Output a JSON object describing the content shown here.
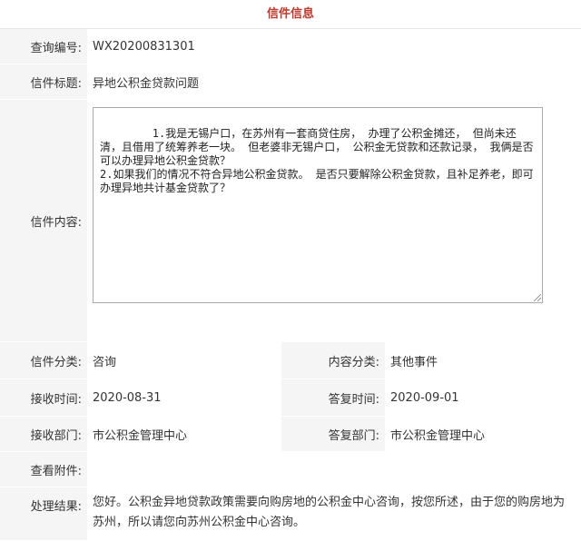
{
  "header": {
    "title": "信件信息"
  },
  "fields": {
    "query_no": {
      "label": "查询编号:",
      "value": "WX20200831301"
    },
    "subject": {
      "label": "信件标题:",
      "value": "异地公积金贷款问题"
    },
    "content": {
      "label": "信件内容:",
      "value": "1.我是无锡户口，在苏州有一套商贷住房， 办理了公积金摊还， 但尚未还清，且借用了统筹养老一块。 但老婆非无锡户口， 公积金无贷款和还款记录， 我俩是否可以办理异地公积金贷款？\n2.如果我们的情况不符合异地公积金贷款。 是否只要解除公积金贷款，且补足养老，即可办理异地共计基金贷款了？"
    },
    "category": {
      "label": "信件分类:",
      "value": "咨询"
    },
    "content_category": {
      "label": "内容分类:",
      "value": "其他事件"
    },
    "receive_time": {
      "label": "接收时间:",
      "value": "2020-08-31"
    },
    "reply_time": {
      "label": "答复时间:",
      "value": "2020-09-01"
    },
    "receive_dept": {
      "label": "接收部门:",
      "value": "市公积金管理中心"
    },
    "reply_dept": {
      "label": "答复部门:",
      "value": "市公积金管理中心"
    },
    "attachments": {
      "label": "查看附件:",
      "value": ""
    },
    "result": {
      "label": "处理结果:",
      "value": "您好。公积金异地贷款政策需要向购房地的公积金中心咨询，按您所述，由于您的购房地为苏州，所以请您向苏州公积金中心咨询。"
    }
  }
}
